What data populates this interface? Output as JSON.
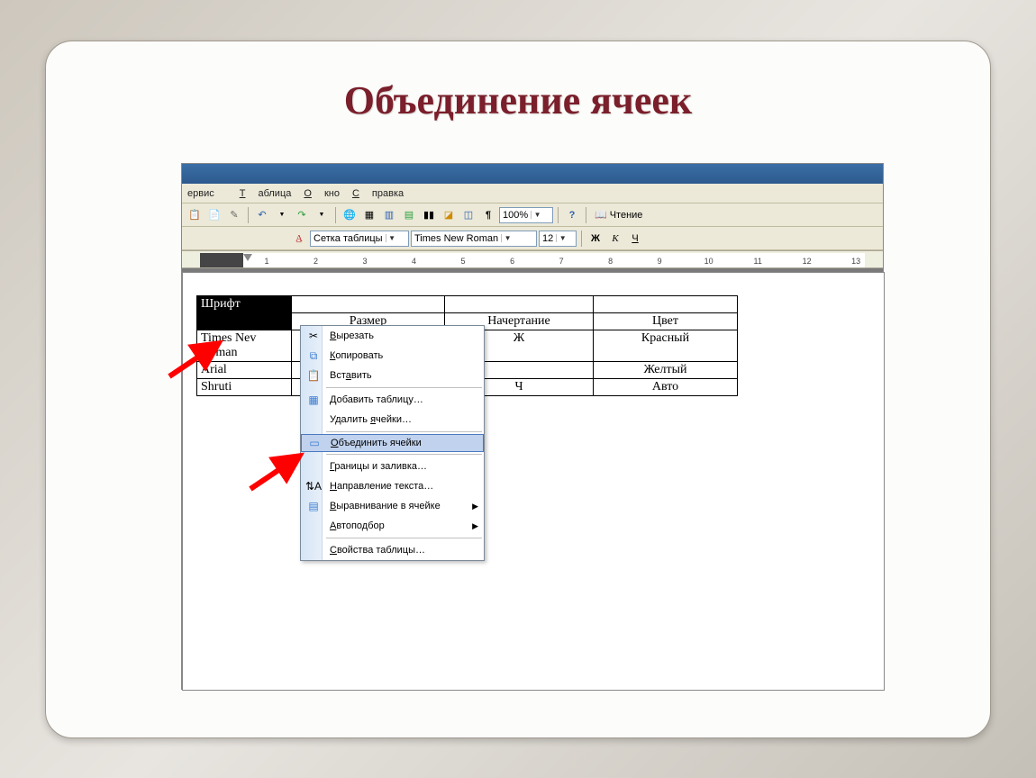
{
  "slide": {
    "title": "Объединение ячеек"
  },
  "menubar": {
    "items": [
      "ервис",
      "Таблица",
      "Окно",
      "Справка"
    ]
  },
  "toolbar": {
    "zoom": "100%",
    "read_label": "Чтение"
  },
  "format_toolbar": {
    "style_label": "Сетка таблицы",
    "font": "Times New Roman",
    "size": "12",
    "bold": "Ж",
    "italic": "К",
    "underline": "Ч"
  },
  "ruler": {
    "ticks": [
      "1",
      "2",
      "3",
      "4",
      "5",
      "6",
      "7",
      "8",
      "9",
      "10",
      "11",
      "12",
      "13"
    ]
  },
  "table": {
    "r1c1": "Шрифт",
    "r2c2": "Размер",
    "r2c3": "Начертание",
    "r2c4": "Цвет",
    "r3c1a": "Times Nev",
    "r3c1b": "Roman",
    "r3c3": "Ж",
    "r3c4": "Красный",
    "r4c1": "Arial",
    "r4c4": "Желтый",
    "r5c1": "Shruti",
    "r5c3": "Ч",
    "r5c4": "Авто"
  },
  "context_menu": {
    "cut": "Вырезать",
    "copy": "Копировать",
    "paste": "Вставить",
    "insert_table": "Добавить таблицу…",
    "delete_cells": "Удалить ячейки…",
    "merge_cells": "Объединить ячейки",
    "borders": "Границы и заливка…",
    "text_direction": "Направление текста…",
    "align": "Выравнивание в ячейке",
    "autofit": "Автоподбор",
    "properties": "Свойства таблицы…"
  }
}
